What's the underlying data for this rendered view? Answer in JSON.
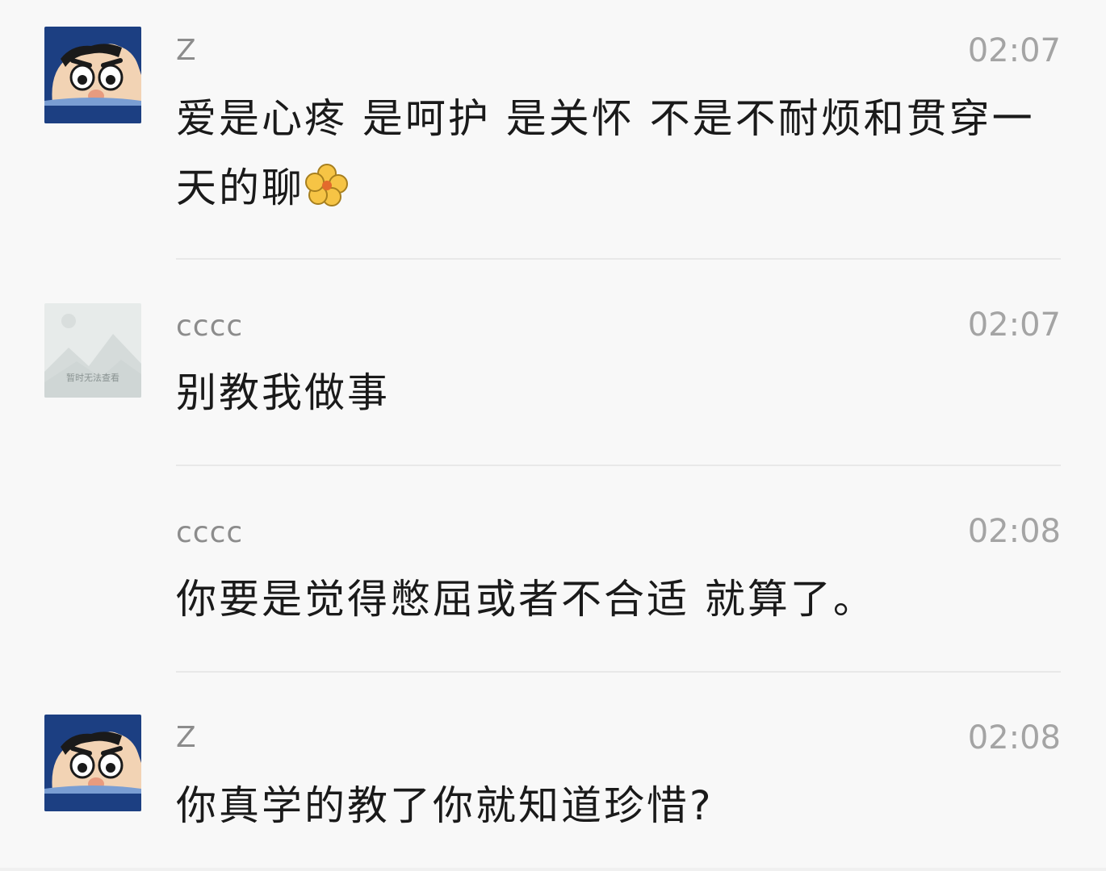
{
  "messages": [
    {
      "sender": "Z",
      "time": "02:07",
      "text": "爱是心疼 是呵护 是关怀 不是不耐烦和贯穿一天的聊",
      "text_tail": "",
      "emoji": "flower-icon",
      "avatar": "cartoon-boy-avatar",
      "show_avatar": true
    },
    {
      "sender": "cccc",
      "time": "02:07",
      "text": "别教我做事",
      "avatar": "placeholder-image-avatar",
      "avatar_caption": "暂时无法查看",
      "show_avatar": true
    },
    {
      "sender": "cccc",
      "time": "02:08",
      "text": "你要是觉得憋屈或者不合适 就算了。",
      "show_avatar": false
    },
    {
      "sender": "Z",
      "time": "02:08",
      "text": "你真学的教了你就知道珍惜?",
      "avatar": "cartoon-boy-avatar",
      "show_avatar": true
    }
  ],
  "colors": {
    "background": "#f8f8f8",
    "sender": "#8c8c8c",
    "time": "#a4a4a4",
    "text": "#1a1a1a",
    "divider": "#e8e8e8",
    "avatar_blue": "#1c3f82"
  }
}
